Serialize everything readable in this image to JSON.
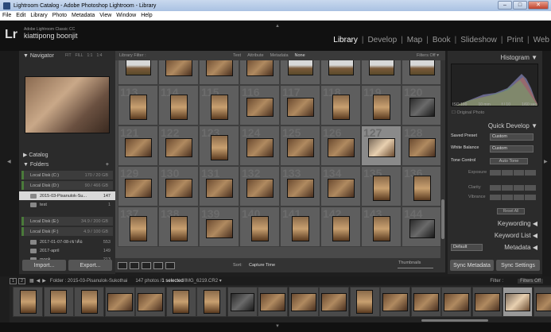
{
  "window": {
    "title": "Lightroom Catalog - Adobe Photoshop Lightroom - Library",
    "min_label": "–",
    "max_label": "□",
    "close_label": "✕"
  },
  "menu": [
    "File",
    "Edit",
    "Library",
    "Photo",
    "Metadata",
    "View",
    "Window",
    "Help"
  ],
  "identity": {
    "logo": "Lr",
    "product": "Adobe Lightroom Classic CC",
    "owner": "kiattipong boonjit"
  },
  "modules": {
    "items": [
      "Library",
      "Develop",
      "Map",
      "Book",
      "Slideshow",
      "Print",
      "Web"
    ],
    "separator": "|",
    "active": "Library"
  },
  "left_panel": {
    "navigator": {
      "title": "Navigator",
      "options": [
        "FIT",
        "FILL",
        "1:1",
        "1:4"
      ]
    },
    "catalog": {
      "title": "Catalog"
    },
    "folders": {
      "title": "Folders",
      "add": "+"
    },
    "disks": [
      {
        "name": "Local Disk (C:)",
        "capacity": "170 / 20 GB"
      },
      {
        "name": "Local Disk (D:)",
        "capacity": "90 / 466 GB"
      }
    ],
    "disk_d_children": [
      {
        "name": "2015-03-Pisanulok-Su...",
        "count": "147",
        "selected": true
      },
      {
        "name": "test",
        "count": "1"
      }
    ],
    "disk_e": {
      "name": "Local Disk (E:)",
      "capacity": "34.9 / 200 GB"
    },
    "disk_f": {
      "name": "Local Disk (F:)",
      "capacity": "4.9 / 100 GB"
    },
    "disk_f_children": [
      {
        "name": "2017-01-07-08-เขาค้อ",
        "count": "553"
      },
      {
        "name": "2017-april",
        "count": "149"
      },
      {
        "name": "mook",
        "count": "213"
      }
    ],
    "buttons": {
      "import": "Import...",
      "export": "Export..."
    }
  },
  "filter_bar": {
    "label": "Library Filter :",
    "links": [
      "Text",
      "Attribute",
      "Metadata",
      "None"
    ],
    "active": "None",
    "filters_off": "Filters Off ▾"
  },
  "grid": {
    "columns": 8,
    "cells": [
      {
        "num": "",
        "tone": "sky"
      },
      {
        "num": "",
        "tone": "warm"
      },
      {
        "num": "",
        "tone": "warm"
      },
      {
        "num": "",
        "tone": "warm"
      },
      {
        "num": "",
        "tone": "sky"
      },
      {
        "num": "",
        "tone": "sky"
      },
      {
        "num": "",
        "tone": "sky"
      },
      {
        "num": "",
        "tone": "sky"
      },
      {
        "num": "113",
        "tone": "portrait"
      },
      {
        "num": "114",
        "tone": "portrait"
      },
      {
        "num": "115",
        "tone": "portrait"
      },
      {
        "num": "116",
        "tone": "warm"
      },
      {
        "num": "117",
        "tone": "warm"
      },
      {
        "num": "118",
        "tone": "portrait"
      },
      {
        "num": "119",
        "tone": "portrait"
      },
      {
        "num": "120",
        "tone": "dark"
      },
      {
        "num": "121",
        "tone": "warm"
      },
      {
        "num": "122",
        "tone": "warm"
      },
      {
        "num": "123",
        "tone": "portrait"
      },
      {
        "num": "124",
        "tone": "warm"
      },
      {
        "num": "125",
        "tone": "warm"
      },
      {
        "num": "126",
        "tone": "warm"
      },
      {
        "num": "127",
        "tone": "sel"
      },
      {
        "num": "128",
        "tone": "warm"
      },
      {
        "num": "129",
        "tone": "warm"
      },
      {
        "num": "130",
        "tone": "warm"
      },
      {
        "num": "131",
        "tone": "warm"
      },
      {
        "num": "132",
        "tone": "warm"
      },
      {
        "num": "133",
        "tone": "warm"
      },
      {
        "num": "134",
        "tone": "warm"
      },
      {
        "num": "135",
        "tone": "portrait"
      },
      {
        "num": "136",
        "tone": "portrait"
      },
      {
        "num": "137",
        "tone": "portrait"
      },
      {
        "num": "138",
        "tone": "portrait"
      },
      {
        "num": "139",
        "tone": "warm"
      },
      {
        "num": "140",
        "tone": "portrait"
      },
      {
        "num": "141",
        "tone": "portrait"
      },
      {
        "num": "142",
        "tone": "portrait"
      },
      {
        "num": "143",
        "tone": "portrait"
      },
      {
        "num": "144",
        "tone": "dark"
      }
    ]
  },
  "toolbar": {
    "sort_label": "Sort:",
    "sort_value": "Capture Time",
    "thumbnails_label": "Thumbnails"
  },
  "right_panel": {
    "histogram": {
      "title": "Histogram",
      "iso": "ISO 100",
      "focal": "10 mm",
      "aperture": "f / 10",
      "shutter": "1/60 sec",
      "original_photo": "Original Photo"
    },
    "quick_develop": {
      "title": "Quick Develop",
      "saved_preset_label": "Saved Preset",
      "saved_preset_value": "Custom",
      "white_balance_label": "White Balance",
      "white_balance_value": "Custom",
      "tone_control_label": "Tone Control",
      "auto_tone": "Auto Tone",
      "exposure": "Exposure",
      "clarity": "Clarity",
      "vibrance": "Vibrance",
      "reset_all": "Reset All"
    },
    "keywording": "Keywording",
    "keyword_list": "Keyword List",
    "metadata": {
      "title": "Metadata",
      "preset": "Default"
    },
    "buttons": {
      "sync_metadata": "Sync Metadata",
      "sync_settings": "Sync Settings"
    }
  },
  "secondary_bar": {
    "pages": [
      "1",
      "2"
    ],
    "folder": "Folder : 2015-03-Pisanulok-Sukothai",
    "count_pre": "147 photos /",
    "count_sel": "1 selected",
    "count_post": "/IMG_6219.CR2 ▾",
    "filter_label": "Filter :",
    "filter_value": "Filters Off"
  },
  "filmstrip": {
    "tiles": [
      "portrait",
      "portrait",
      "portrait",
      "warm",
      "warm",
      "portrait",
      "portrait",
      "dark",
      "warm",
      "warm",
      "warm",
      "portrait",
      "warm",
      "warm",
      "warm",
      "warm",
      "sel",
      "warm",
      "warm"
    ]
  }
}
